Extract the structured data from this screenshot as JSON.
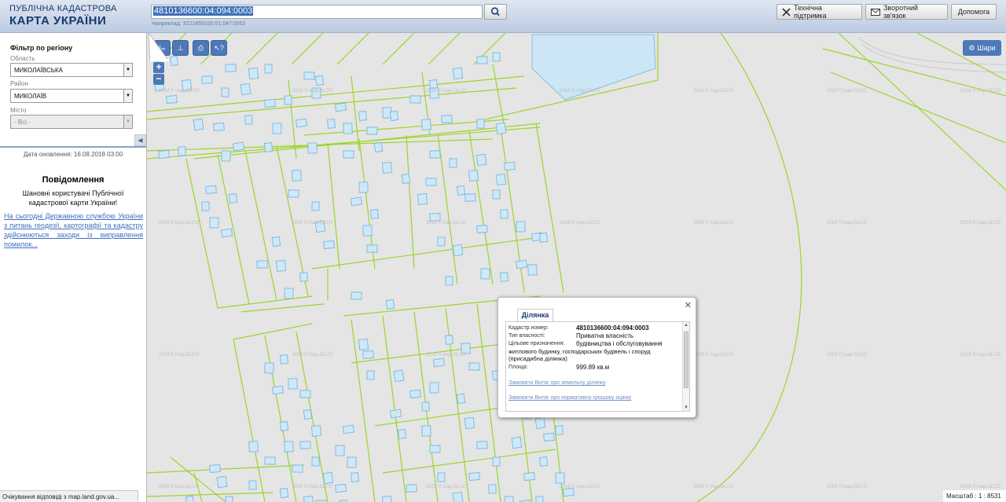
{
  "header": {
    "logo_line1": "ПУБЛІЧНА КАДАСТРОВА",
    "logo_line2": "КАРТА УКРАЇНИ",
    "search_value": "4810136600:04:094:0003",
    "search_hint": "Наприклад: 3221855100:01:047:0052",
    "buttons": [
      "Технічна підтримка",
      "Зворотний зв'язок",
      "Допомога"
    ]
  },
  "sidebar": {
    "filter_title": "Фільтр по регіону",
    "oblast_label": "Область",
    "oblast_value": "МИКОЛАЇВСЬКА",
    "rayon_label": "Район",
    "rayon_value": "МИКОЛАЇВ",
    "misto_label": "Місто",
    "misto_value": "- Всі -",
    "update_date": "Дата оновлення: 16.08.2018 03:00",
    "msg_title": "Повідомлення",
    "msg_body": "Шановні користувачі Публічної кадастрової карти України!",
    "msg_link": "На сьогодні Державною службою України з питань геодезії, картографії та кадастру здійснюються заходи із виправлення помилок..."
  },
  "map": {
    "layers_label": "Шари",
    "scale_text": "Масштаб : 1 : 8531",
    "watermark": "2018 © map.DLCO"
  },
  "popup": {
    "tab": "Ділянка",
    "fields": [
      {
        "label": "Кадастр.номер:",
        "value": "4810136600:04:094:0003"
      },
      {
        "label": "Тип власності:",
        "value": "Приватна власність"
      },
      {
        "label": "Цільове призначення:",
        "value": "будівництва і обслуговування"
      },
      {
        "label": "Площа:",
        "value": "999.89 кв.м"
      }
    ],
    "purpose_text": "житлового будинку, господарських будівель і споруд (присадибна ділянка)",
    "link1": "Замовити Витяг про земельну ділянку",
    "link2": "Замовити Витяг про нормативну грошову оцінку"
  },
  "status_text": "Очікування відповіді з map.land.gov.ua...",
  "colors": {
    "parcel_border": "#9bd52a",
    "building_fill": "#cde6f5",
    "building_border": "#7ab5de",
    "accent": "#4d79b8"
  }
}
